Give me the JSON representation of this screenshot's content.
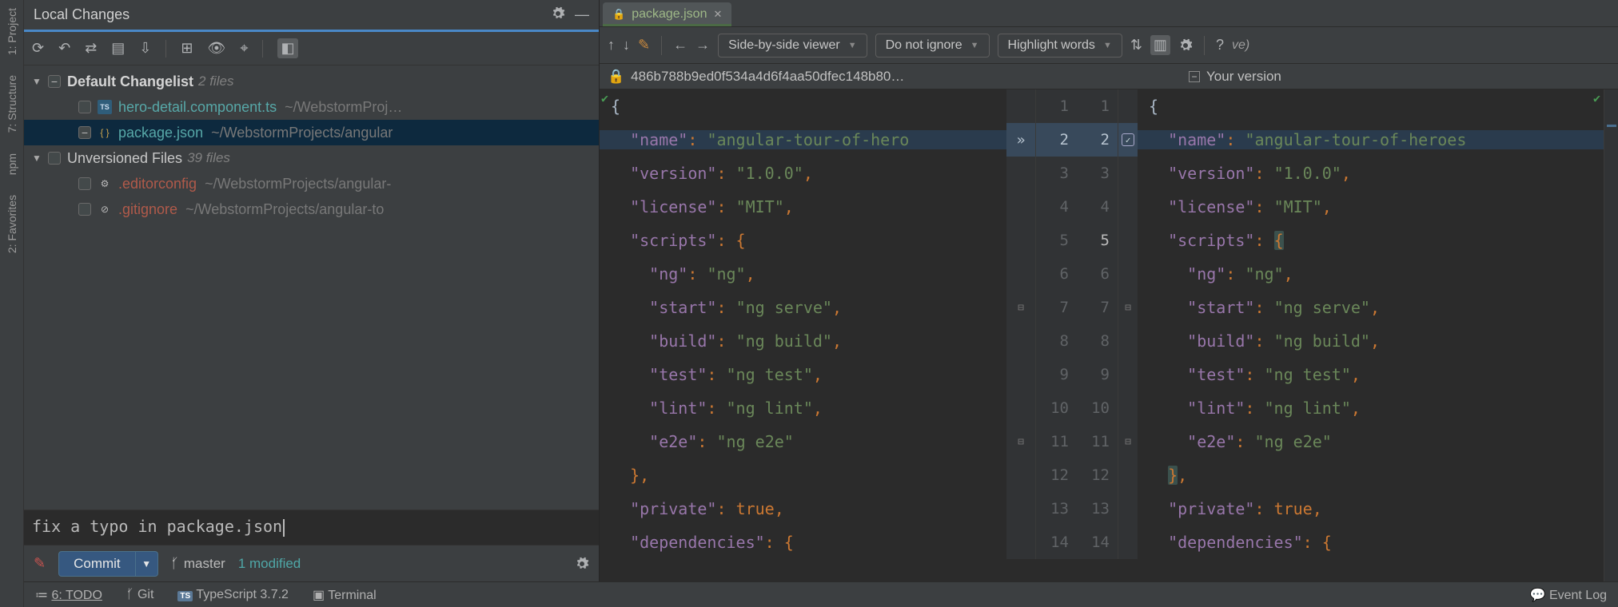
{
  "rail": {
    "project": "1: Project",
    "structure": "7: Structure",
    "npm": "npm",
    "favorites": "2: Favorites"
  },
  "local_changes": {
    "title": "Local Changes",
    "toolbar_icons": [
      "refresh",
      "undo",
      "swap",
      "identify",
      "download",
      "sep",
      "grid",
      "eye",
      "target",
      "sep",
      "sidebar"
    ],
    "changelist": {
      "label": "Default Changelist",
      "count": "2 files"
    },
    "files": [
      {
        "name": "hero-detail.component.ts",
        "path": "~/WebstormProj…",
        "type": "ts"
      },
      {
        "name": "package.json",
        "path": "~/WebstormProjects/angular",
        "type": "json",
        "selected": true
      }
    ],
    "unversioned": {
      "label": "Unversioned Files",
      "count": "39 files"
    },
    "unversioned_files": [
      {
        "name": ".editorconfig",
        "path": "~/WebstormProjects/angular-",
        "icon": "gear"
      },
      {
        "name": ".gitignore",
        "path": "~/WebstormProjects/angular-to",
        "icon": "blocked"
      }
    ],
    "commit_message": "fix a typo in package.json",
    "commit_button": "Commit",
    "branch": "master",
    "modified": "1 modified"
  },
  "diff": {
    "tab_name": "package.json",
    "toolbar": {
      "viewer": "Side-by-side viewer",
      "ignore": "Do not ignore",
      "highlight": "Highlight words"
    },
    "header": {
      "left": "486b788b9ed0f534a4d6f4aa50dfec148b80…",
      "right": "Your version"
    },
    "help_hint": "ve)",
    "lines": [
      {
        "n": 1,
        "left": "{",
        "right": "{"
      },
      {
        "n": 2,
        "changed": true,
        "left": [
          [
            "pun",
            "  "
          ],
          [
            "key",
            "\"name\""
          ],
          [
            "pun",
            ": "
          ],
          [
            "str",
            "\"angular-tour-of-hero"
          ]
        ],
        "right": [
          [
            "pun",
            "  "
          ],
          [
            "key",
            "\"name\""
          ],
          [
            "pun",
            ": "
          ],
          [
            "str",
            "\"angular-tour-of-heroes"
          ]
        ],
        "accept": true
      },
      {
        "n": 3,
        "left": [
          [
            "pun",
            "  "
          ],
          [
            "key",
            "\"version\""
          ],
          [
            "pun",
            ": "
          ],
          [
            "str",
            "\"1.0.0\""
          ],
          [
            "pun",
            ","
          ]
        ],
        "right": [
          [
            "pun",
            "  "
          ],
          [
            "key",
            "\"version\""
          ],
          [
            "pun",
            ": "
          ],
          [
            "str",
            "\"1.0.0\""
          ],
          [
            "pun",
            ","
          ]
        ]
      },
      {
        "n": 4,
        "left": [
          [
            "pun",
            "  "
          ],
          [
            "key",
            "\"license\""
          ],
          [
            "pun",
            ": "
          ],
          [
            "str",
            "\"MIT\""
          ],
          [
            "pun",
            ","
          ]
        ],
        "right": [
          [
            "pun",
            "  "
          ],
          [
            "key",
            "\"license\""
          ],
          [
            "pun",
            ": "
          ],
          [
            "str",
            "\"MIT\""
          ],
          [
            "pun",
            ","
          ]
        ]
      },
      {
        "n": 5,
        "boldr": true,
        "left": [
          [
            "pun",
            "  "
          ],
          [
            "key",
            "\"scripts\""
          ],
          [
            "pun",
            ": {"
          ]
        ],
        "right": [
          [
            "pun",
            "  "
          ],
          [
            "key",
            "\"scripts\""
          ],
          [
            "pun",
            ": "
          ],
          [
            "brace",
            "{"
          ]
        ]
      },
      {
        "n": 6,
        "left": [
          [
            "pun",
            "    "
          ],
          [
            "key",
            "\"ng\""
          ],
          [
            "pun",
            ": "
          ],
          [
            "str",
            "\"ng\""
          ],
          [
            "pun",
            ","
          ]
        ],
        "right": [
          [
            "pun",
            "    "
          ],
          [
            "key",
            "\"ng\""
          ],
          [
            "pun",
            ": "
          ],
          [
            "str",
            "\"ng\""
          ],
          [
            "pun",
            ","
          ]
        ]
      },
      {
        "n": 7,
        "fold": true,
        "left": [
          [
            "pun",
            "    "
          ],
          [
            "key",
            "\"start\""
          ],
          [
            "pun",
            ": "
          ],
          [
            "str",
            "\"ng serve\""
          ],
          [
            "pun",
            ","
          ]
        ],
        "right": [
          [
            "pun",
            "    "
          ],
          [
            "key",
            "\"start\""
          ],
          [
            "pun",
            ": "
          ],
          [
            "str",
            "\"ng serve\""
          ],
          [
            "pun",
            ","
          ]
        ]
      },
      {
        "n": 8,
        "left": [
          [
            "pun",
            "    "
          ],
          [
            "key",
            "\"build\""
          ],
          [
            "pun",
            ": "
          ],
          [
            "str",
            "\"ng build\""
          ],
          [
            "pun",
            ","
          ]
        ],
        "right": [
          [
            "pun",
            "    "
          ],
          [
            "key",
            "\"build\""
          ],
          [
            "pun",
            ": "
          ],
          [
            "str",
            "\"ng build\""
          ],
          [
            "pun",
            ","
          ]
        ]
      },
      {
        "n": 9,
        "left": [
          [
            "pun",
            "    "
          ],
          [
            "key",
            "\"test\""
          ],
          [
            "pun",
            ": "
          ],
          [
            "str",
            "\"ng test\""
          ],
          [
            "pun",
            ","
          ]
        ],
        "right": [
          [
            "pun",
            "    "
          ],
          [
            "key",
            "\"test\""
          ],
          [
            "pun",
            ": "
          ],
          [
            "str",
            "\"ng test\""
          ],
          [
            "pun",
            ","
          ]
        ]
      },
      {
        "n": 10,
        "left": [
          [
            "pun",
            "    "
          ],
          [
            "key",
            "\"lint\""
          ],
          [
            "pun",
            ": "
          ],
          [
            "str",
            "\"ng lint\""
          ],
          [
            "pun",
            ","
          ]
        ],
        "right": [
          [
            "pun",
            "    "
          ],
          [
            "key",
            "\"lint\""
          ],
          [
            "pun",
            ": "
          ],
          [
            "str",
            "\"ng lint\""
          ],
          [
            "pun",
            ","
          ]
        ]
      },
      {
        "n": 11,
        "fold": true,
        "left": [
          [
            "pun",
            "    "
          ],
          [
            "key",
            "\"e2e\""
          ],
          [
            "pun",
            ": "
          ],
          [
            "str",
            "\"ng e2e\""
          ]
        ],
        "right": [
          [
            "pun",
            "    "
          ],
          [
            "key",
            "\"e2e\""
          ],
          [
            "pun",
            ": "
          ],
          [
            "str",
            "\"ng e2e\""
          ]
        ]
      },
      {
        "n": 12,
        "left": [
          [
            "pun",
            "  },"
          ]
        ],
        "right": [
          [
            "pun",
            "  "
          ],
          [
            "brace",
            "}"
          ],
          [
            "pun",
            ","
          ]
        ]
      },
      {
        "n": 13,
        "left": [
          [
            "pun",
            "  "
          ],
          [
            "key",
            "\"private\""
          ],
          [
            "pun",
            ": "
          ],
          [
            "bool",
            "true"
          ],
          [
            "pun",
            ","
          ]
        ],
        "right": [
          [
            "pun",
            "  "
          ],
          [
            "key",
            "\"private\""
          ],
          [
            "pun",
            ": "
          ],
          [
            "bool",
            "true"
          ],
          [
            "pun",
            ","
          ]
        ]
      },
      {
        "n": 14,
        "left": [
          [
            "pun",
            "  "
          ],
          [
            "key",
            "\"dependencies\""
          ],
          [
            "pun",
            ": {"
          ]
        ],
        "right": [
          [
            "pun",
            "  "
          ],
          [
            "key",
            "\"dependencies\""
          ],
          [
            "pun",
            ": {"
          ]
        ]
      }
    ]
  },
  "status": {
    "todo": "6: TODO",
    "git": "Git",
    "ts": "TypeScript 3.7.2",
    "terminal": "Terminal",
    "event_log": "Event Log"
  }
}
